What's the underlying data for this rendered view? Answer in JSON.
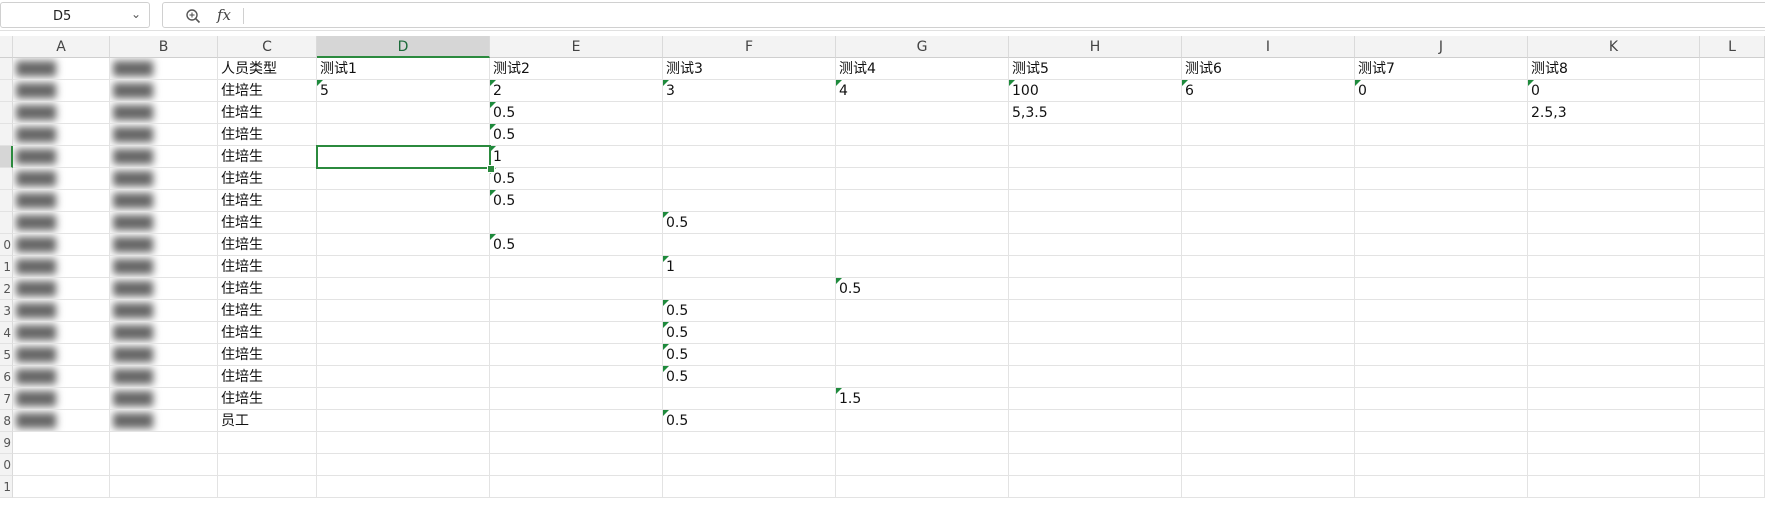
{
  "formula_bar": {
    "name_box": "D5",
    "fx_label": "fx",
    "formula": ""
  },
  "icons": {
    "zoom": "zoom-icon",
    "fx": "fx-icon",
    "dropdown": "chevron-down-icon"
  },
  "colors": {
    "accent": "#2b8a3e",
    "comment_marker": "#1e8a3c"
  },
  "columns": [
    "A",
    "B",
    "C",
    "D",
    "E",
    "F",
    "G",
    "H",
    "I",
    "J",
    "K",
    "L"
  ],
  "active_column": "D",
  "row_numbers": [
    "",
    "",
    "",
    "",
    "",
    "",
    "",
    "",
    "0",
    "1",
    "2",
    "3",
    "4",
    "5",
    "6",
    "7",
    "8",
    "9",
    "0",
    "1"
  ],
  "active_row_index": 4,
  "blurred_row_count": 17,
  "rows": [
    {
      "C": "人员类型",
      "D": "测试1",
      "E": "测试2",
      "F": "测试3",
      "G": "测试4",
      "H": "测试5",
      "I": "测试6",
      "J": "测试7",
      "K": "测试8"
    },
    {
      "C": "住培生",
      "D": "5",
      "E": "2",
      "F": "3",
      "G": "4",
      "H": "100",
      "I": "6",
      "J": "0",
      "K": "0"
    },
    {
      "C": "住培生",
      "E": "0.5",
      "H": "5,3.5",
      "K": "2.5,3"
    },
    {
      "C": "住培生",
      "E": "0.5"
    },
    {
      "C": "住培生",
      "E": "1"
    },
    {
      "C": "住培生",
      "E": "0.5"
    },
    {
      "C": "住培生",
      "E": "0.5"
    },
    {
      "C": "住培生",
      "F": "0.5"
    },
    {
      "C": "住培生",
      "E": "0.5"
    },
    {
      "C": "住培生",
      "F": "1"
    },
    {
      "C": "住培生",
      "G": "0.5"
    },
    {
      "C": "住培生",
      "F": "0.5"
    },
    {
      "C": "住培生",
      "F": "0.5"
    },
    {
      "C": "住培生",
      "F": "0.5"
    },
    {
      "C": "住培生",
      "F": "0.5"
    },
    {
      "C": "住培生",
      "G": "1.5"
    },
    {
      "C": "员工",
      "F": "0.5"
    },
    {},
    {},
    {}
  ],
  "text_marked": [
    [
      1,
      "D"
    ],
    [
      1,
      "E"
    ],
    [
      1,
      "F"
    ],
    [
      1,
      "G"
    ],
    [
      1,
      "H"
    ],
    [
      1,
      "I"
    ],
    [
      1,
      "J"
    ],
    [
      1,
      "K"
    ],
    [
      2,
      "E"
    ],
    [
      3,
      "E"
    ],
    [
      4,
      "E"
    ],
    [
      5,
      "E"
    ],
    [
      6,
      "E"
    ],
    [
      7,
      "F"
    ],
    [
      8,
      "E"
    ],
    [
      9,
      "F"
    ],
    [
      10,
      "G"
    ],
    [
      11,
      "F"
    ],
    [
      12,
      "F"
    ],
    [
      13,
      "F"
    ],
    [
      14,
      "F"
    ],
    [
      15,
      "G"
    ],
    [
      16,
      "F"
    ]
  ]
}
